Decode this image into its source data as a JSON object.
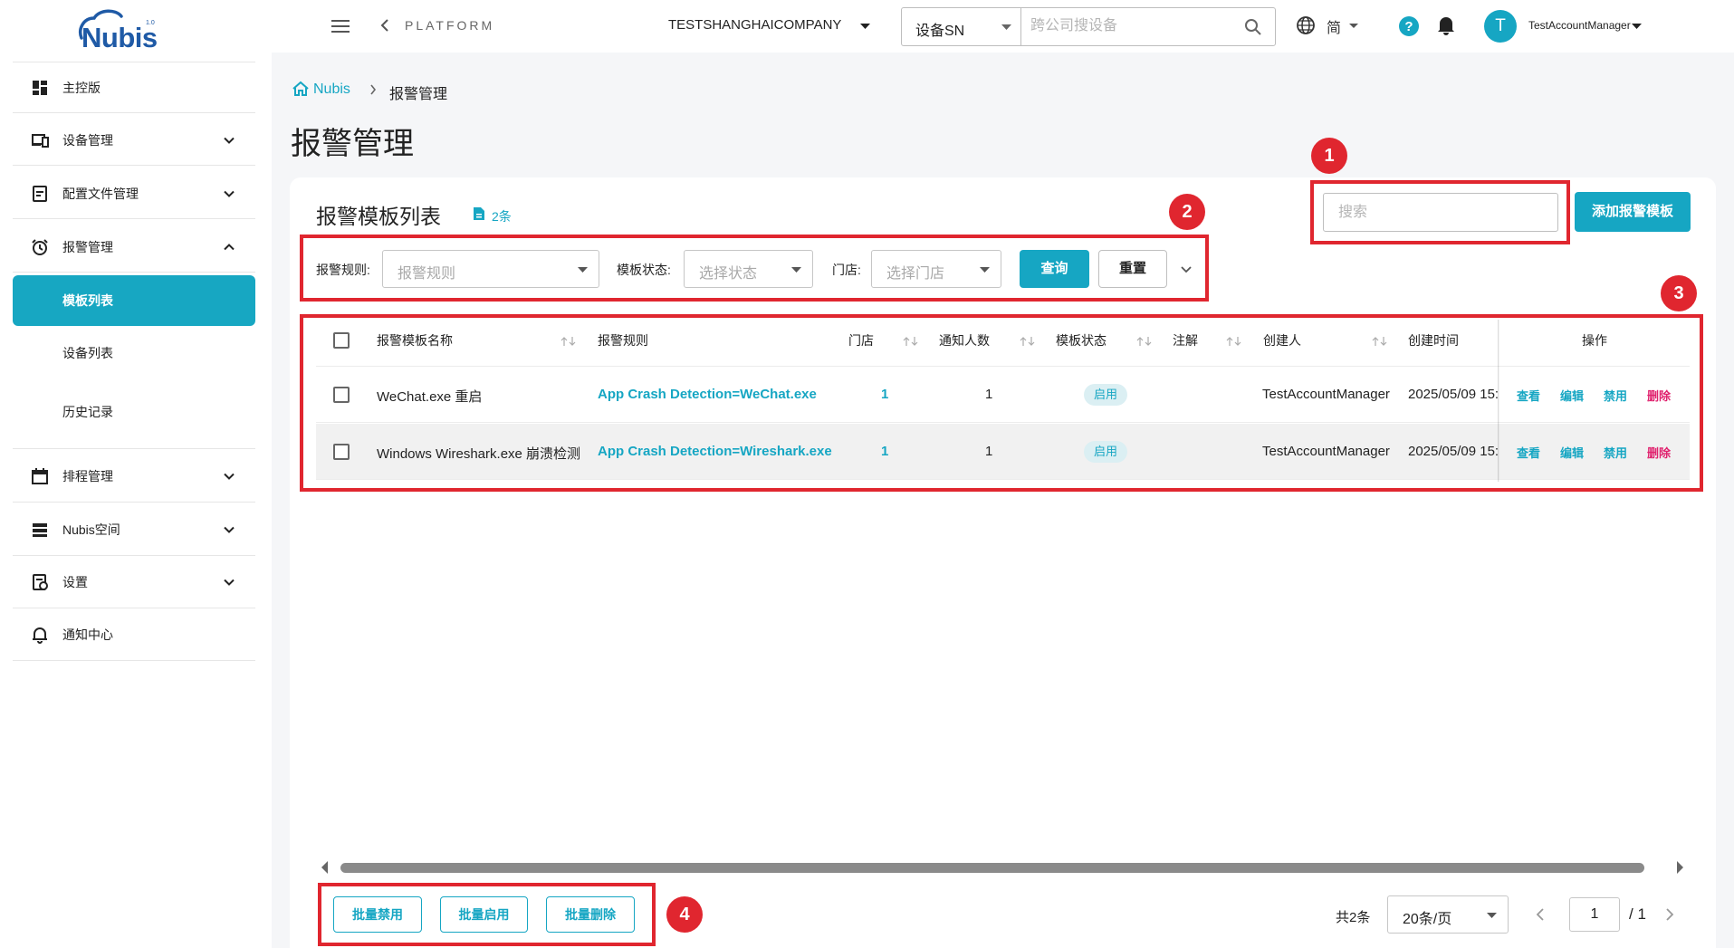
{
  "app": {
    "logo_text": "Nubis",
    "logo_sup": "1.0"
  },
  "sidebar": {
    "items": [
      {
        "label": "主控版",
        "icon": "dashboard-icon"
      },
      {
        "label": "设备管理",
        "icon": "devices-icon"
      },
      {
        "label": "配置文件管理",
        "icon": "config-file-icon"
      },
      {
        "label": "报警管理",
        "icon": "alarm-clock-icon"
      },
      {
        "label": "排程管理",
        "icon": "calendar-icon"
      },
      {
        "label": "Nubis空间",
        "icon": "storage-icon"
      },
      {
        "label": "设置",
        "icon": "settings-doc-icon"
      },
      {
        "label": "通知中心",
        "icon": "bell-icon"
      }
    ],
    "alarm_sub": [
      "模板列表",
      "设备列表",
      "历史记录"
    ]
  },
  "header": {
    "platform": "PLATFORM",
    "company": "TESTSHANGHAICOMPANY",
    "sn_select": "设备SN",
    "sn_placeholder": "跨公司搜设备",
    "lang": "简",
    "avatar_letter": "T",
    "username": "TestAccountManager"
  },
  "breadcrumb": {
    "home": "Nubis",
    "current": "报警管理"
  },
  "page_title": "报警管理",
  "list": {
    "title": "报警模板列表",
    "count": "2条",
    "search_placeholder": "搜索",
    "add_button": "添加报警模板"
  },
  "filters": {
    "rule_label": "报警规则:",
    "rule_placeholder": "报警规则",
    "status_label": "模板状态:",
    "status_placeholder": "选择状态",
    "store_label": "门店:",
    "store_placeholder": "选择门店",
    "query_button": "查询",
    "reset_button": "重置"
  },
  "table": {
    "headers": [
      "报警模板名称",
      "报警规则",
      "门店",
      "通知人数",
      "模板状态",
      "注解",
      "创建人",
      "创建时间",
      "操作"
    ],
    "rows": [
      {
        "name": "WeChat.exe 重启",
        "rule": "App Crash Detection=WeChat.exe",
        "store": "1",
        "notify": "1",
        "status": "启用",
        "note": "",
        "creator": "TestAccountManager",
        "created": "2025/05/09 15:"
      },
      {
        "name": "Windows Wireshark.exe 崩溃检测",
        "rule": "App Crash Detection=Wireshark.exe",
        "store": "1",
        "notify": "1",
        "status": "启用",
        "note": "",
        "creator": "TestAccountManager",
        "created": "2025/05/09 15:"
      }
    ],
    "actions": {
      "view": "查看",
      "edit": "编辑",
      "disable": "禁用",
      "delete": "删除"
    }
  },
  "batch": {
    "disable": "批量禁用",
    "enable": "批量启用",
    "delete": "批量删除"
  },
  "pagination": {
    "total": "共2条",
    "page_size": "20条/页",
    "page": "1",
    "of": "/ 1"
  },
  "annotations": [
    "1",
    "2",
    "3",
    "4"
  ],
  "colors": {
    "accent": "#16a6c3",
    "danger": "#e0226e",
    "annotation": "#e0262f",
    "logo": "#1f5aa6"
  }
}
